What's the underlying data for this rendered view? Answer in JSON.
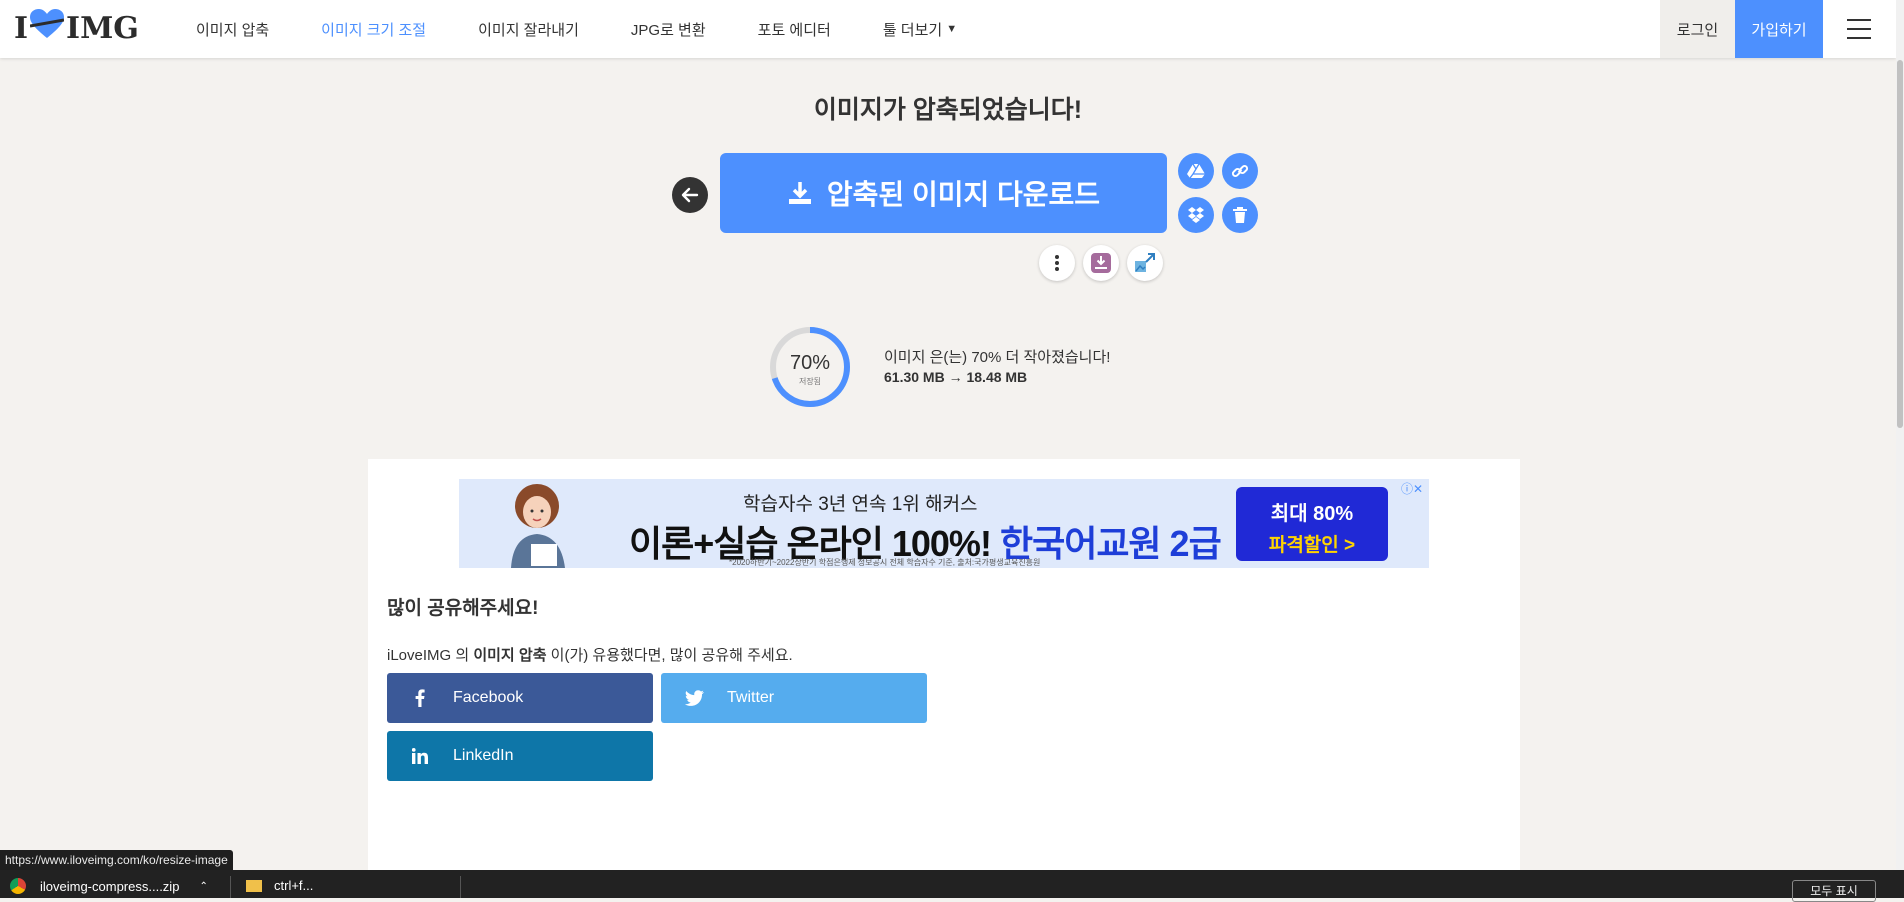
{
  "header": {
    "logo_left": "I",
    "logo_right": "IMG",
    "nav": [
      {
        "label": "이미지 압축",
        "active": false
      },
      {
        "label": "이미지 크기 조절",
        "active": true
      },
      {
        "label": "이미지 잘라내기",
        "active": false
      },
      {
        "label": "JPG로 변환",
        "active": false
      },
      {
        "label": "포토 에디터",
        "active": false
      },
      {
        "label": "툴 더보기",
        "active": false
      }
    ],
    "login": "로그인",
    "signup": "가입하기"
  },
  "result": {
    "headline": "이미지가 압축되었습니다!",
    "download_label": "압축된 이미지 다운로드",
    "percent_label": "70%",
    "percent_value": 70,
    "saved_label": "저장됨",
    "summary": "이미지 은(는) 70% 더 작아졌습니다!",
    "sizes": "61.30 MB → 18.48 MB"
  },
  "ad": {
    "line1": "학습자수 3년 연속 1위 해커스",
    "line2_black": "이론+실습 온라인 100%!",
    "line2_blue": "한국어교원 2급",
    "fine_print": "*2020하반기~2022상반기 학점은행제 정보공시 전체 학습자수 기준, 출처:국가평생교육진흥원",
    "cta1": "최대 80%",
    "cta2": "파격할인 >"
  },
  "share": {
    "title": "많이 공유해주세요!",
    "text_prefix": "iLoveIMG 의 ",
    "text_bold": "이미지 압축",
    "text_suffix": " 이(가) 유용했다면, 많이 공유해 주세요.",
    "facebook": "Facebook",
    "twitter": "Twitter",
    "linkedin": "LinkedIn"
  },
  "status": {
    "url": "https://www.iloveimg.com/ko/resize-image"
  },
  "taskbar": {
    "download_file": "iloveimg-compress....zip",
    "second_item": "ctrl+f...",
    "show_all": "모두 표시"
  },
  "colors": {
    "accent": "#4d90fe",
    "facebook": "#3b5998",
    "twitter": "#55acee",
    "linkedin": "#0e76a8"
  }
}
